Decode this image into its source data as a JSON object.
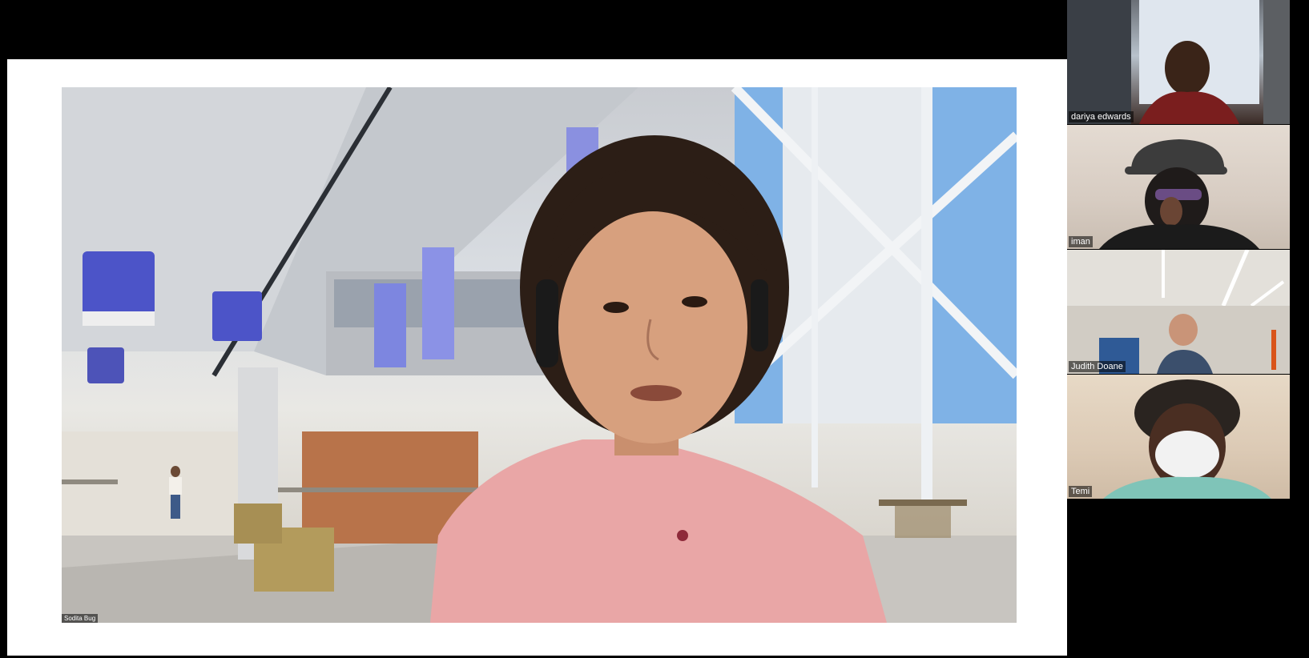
{
  "main_speaker": {
    "name": "Sodita Bug"
  },
  "gallery": [
    {
      "name": "dariya edwards"
    },
    {
      "name": "iman"
    },
    {
      "name": "Judith Doane"
    },
    {
      "name": "Temi"
    }
  ],
  "colors": {
    "background": "#000000",
    "share_background": "#ffffff",
    "name_tag_bg": "rgba(0,0,0,0.55)",
    "name_tag_text": "#ffffff"
  }
}
